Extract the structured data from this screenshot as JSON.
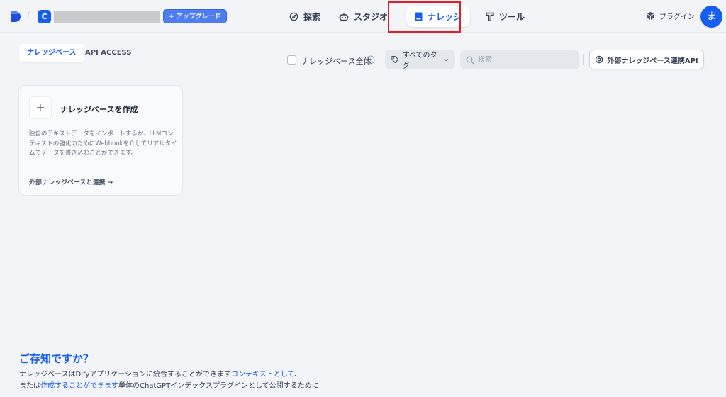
{
  "header": {
    "workspace_initial": "C",
    "upgrade_label": "+ アップグレード",
    "nav": [
      {
        "label": "探索",
        "icon": "compass-icon"
      },
      {
        "label": "スタジオ",
        "icon": "robot-icon"
      },
      {
        "label": "ナレッジ",
        "icon": "book-icon",
        "active": true
      },
      {
        "label": "ツール",
        "icon": "hammer-icon"
      }
    ],
    "plugins_label": "プラグイン",
    "avatar_initial": "ま"
  },
  "tabs": [
    {
      "label": "ナレッジベース",
      "active": true
    },
    {
      "label": "API ACCESS",
      "active": false
    }
  ],
  "toolbar": {
    "all_knowledge_label": "ナレッジベース全体",
    "tag_filter_label": "すべてのタグ",
    "search_placeholder": "検索",
    "external_api_label": "外部ナレッジベース連携API"
  },
  "create_card": {
    "title": "ナレッジベースを作成",
    "description": "独自のテキストデータをインポートするか、LLMコンテキストの強化のためにWebhookを介してリアルタイムでデータを書き込むことができます。",
    "link_label": "外部ナレッジベースと連携 →"
  },
  "tip": {
    "title": "ご存知ですか？",
    "line1_text": "ナレッジベースはDifyアプリケーションに統合することができます",
    "line1_link": "コンテキストとして",
    "line1_end": "、",
    "line2_start": "または",
    "line2_link": "作成することができます",
    "line2_end": "単体のChatGPTインデックスプラグインとして公開するために"
  },
  "colors": {
    "accent": "#155eef",
    "highlight_border": "#e11d28",
    "background": "#f2f4f7"
  }
}
